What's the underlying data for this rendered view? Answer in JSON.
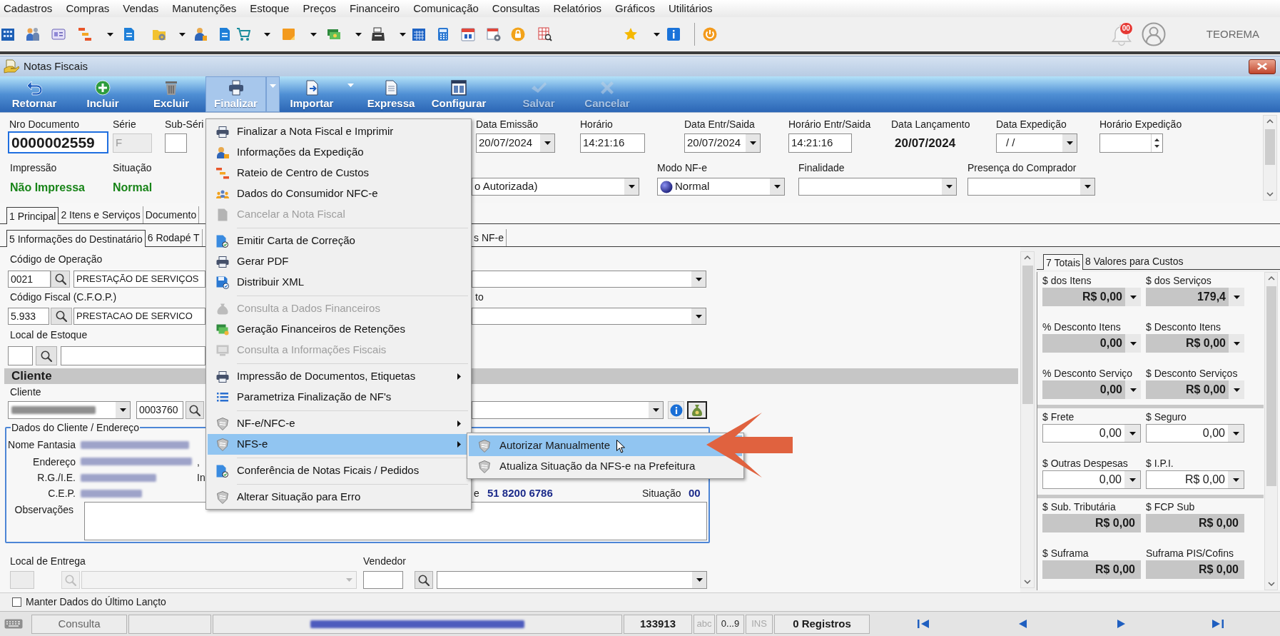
{
  "menu_bar": [
    "Cadastros",
    "Compras",
    "Vendas",
    "Manutenções",
    "Estoque",
    "Preços",
    "Financeiro",
    "Comunicação",
    "Consultas",
    "Relatórios",
    "Gráficos",
    "Utilitários"
  ],
  "top_bar": {
    "notification_count": "00",
    "user_name": "TEOREMA"
  },
  "window": {
    "title": "Notas Fiscais"
  },
  "ribbon": [
    {
      "label": "Retornar",
      "selected": false,
      "disabled": false,
      "dropdown": false
    },
    {
      "label": "Incluir",
      "selected": false,
      "disabled": false,
      "dropdown": false
    },
    {
      "label": "Excluir",
      "selected": false,
      "disabled": false,
      "dropdown": false
    },
    {
      "label": "Finalizar",
      "selected": true,
      "disabled": false,
      "dropdown": true
    },
    {
      "label": "Importar",
      "selected": false,
      "disabled": false,
      "dropdown": true
    },
    {
      "label": "Expressa",
      "selected": false,
      "disabled": false,
      "dropdown": false
    },
    {
      "label": "Configurar",
      "selected": false,
      "disabled": false,
      "dropdown": false
    },
    {
      "label": "Salvar",
      "selected": false,
      "disabled": true,
      "dropdown": false
    },
    {
      "label": "Cancelar",
      "selected": false,
      "disabled": true,
      "dropdown": false
    }
  ],
  "header": {
    "document_number": {
      "label": "Nro Documento",
      "value": "0000002559",
      "focused": true
    },
    "series": {
      "label": "Série",
      "value": "F",
      "disabled": true
    },
    "sub_series": {
      "label": "Sub-Séri"
    },
    "issue_date": {
      "label": "Data Emissão",
      "value": "20/07/2024"
    },
    "issue_time": {
      "label": "Horário",
      "value": "14:21:16"
    },
    "entry_exit_date": {
      "label": "Data Entr/Saida",
      "value": "20/07/2024"
    },
    "entry_exit_time": {
      "label": "Horário Entr/Saida",
      "value": "14:21:16"
    },
    "posting_date": {
      "label": "Data Lançamento",
      "value": "20/07/2024"
    },
    "shipping_date": {
      "label": "Data Expedição",
      "value": "/ /"
    },
    "shipping_time": {
      "label": "Horário Expedição"
    },
    "printing": {
      "label": "Impressão",
      "value": "Não Impressa"
    },
    "situation": {
      "label": "Situação",
      "value": "Normal"
    },
    "status": {
      "value": "o Autorizada)"
    },
    "nfe_mode": {
      "label": "Modo NF-e",
      "value": "Normal"
    },
    "purpose": {
      "label": "Finalidade"
    },
    "buyer_presence": {
      "label": "Presença do Comprador"
    }
  },
  "tabs": [
    {
      "label": "1 Principal",
      "selected": true
    },
    {
      "label": "2 Itens e Serviços",
      "selected": false
    },
    {
      "label": "Documento",
      "selected": false
    }
  ],
  "subtabs": [
    {
      "label": "5 Informações do Destinatário",
      "selected": true
    },
    {
      "label": "6 Rodapé T",
      "selected": false
    },
    {
      "label": "s NF-e",
      "selected": false
    }
  ],
  "form": {
    "operation": {
      "label": "Código de Operação",
      "code": "0021",
      "name": "PRESTAÇÃO DE SERVIÇOS"
    },
    "cfop": {
      "label": "Código Fiscal (C.F.O.P.)",
      "code": "5.933",
      "name": "PRESTACAO DE SERVICO",
      "column_2_label": "to"
    },
    "stock_location": {
      "label": "Local de Estoque"
    },
    "client": {
      "section_title": "Cliente",
      "label": "Cliente",
      "document_redacted": true,
      "code": "0003760"
    },
    "address": {
      "title": "Dados do Cliente / Endereço",
      "rows": [
        {
          "label": "Nome Fantasia",
          "redacted": true
        },
        {
          "label": "Endereço",
          "redacted": true,
          "fragment": ","
        },
        {
          "label": "R.G./I.E.",
          "redacted": true,
          "fragment": "In"
        },
        {
          "label": "C.E.P.",
          "redacted": true,
          "right_fields": [
            {
              "label": "e",
              "value": "51 8200 6786"
            },
            {
              "label": "Situação",
              "value": "00"
            }
          ]
        }
      ],
      "notes_label": "Observações"
    },
    "delivery_location": {
      "label": "Local de Entrega",
      "disabled": true
    },
    "seller": {
      "label": "Vendedor"
    }
  },
  "totals": {
    "tabs": [
      {
        "label": "7 Totais",
        "selected": true
      },
      {
        "label": "8 Valores para Custos",
        "selected": false
      }
    ],
    "sections": [
      [
        {
          "label": "$ dos Itens",
          "value": "R$ 0,00",
          "kind": "computed",
          "dropdown": true
        },
        {
          "label": "$ dos Serviços",
          "value": "179,4",
          "kind": "computed",
          "dropdown": true
        },
        {
          "label": "% Desconto Itens",
          "value": "0,00",
          "kind": "computed",
          "dropdown": true
        },
        {
          "label": "$ Desconto Itens",
          "value": "R$ 0,00",
          "kind": "computed",
          "dropdown": true
        },
        {
          "label": "% Desconto Serviço",
          "value": "0,00",
          "kind": "computed",
          "dropdown": true
        },
        {
          "label": "$ Desconto Serviços",
          "value": "R$ 0,00",
          "kind": "computed",
          "dropdown": true
        }
      ],
      [
        {
          "label": "$ Frete",
          "value": "0,00",
          "kind": "editable",
          "dropdown": true
        },
        {
          "label": "$ Seguro",
          "value": "0,00",
          "kind": "editable",
          "dropdown": true
        },
        {
          "label": "$ Outras Despesas",
          "value": "0,00",
          "kind": "editable",
          "dropdown": true
        },
        {
          "label": "$ I.P.I.",
          "value": "R$ 0,00",
          "kind": "editable",
          "dropdown": true
        }
      ],
      [
        {
          "label": "$ Sub. Tributária",
          "value": "R$ 0,00",
          "kind": "computed",
          "dropdown": false
        },
        {
          "label": "$ FCP Sub",
          "value": "R$ 0,00",
          "kind": "computed",
          "dropdown": false
        },
        {
          "label": "$ Suframa",
          "value": "R$ 0,00",
          "kind": "computed",
          "dropdown": false
        },
        {
          "label": "Suframa PIS/Cofins",
          "value": "R$ 0,00",
          "kind": "computed",
          "dropdown": false
        }
      ]
    ]
  },
  "keep_data": {
    "label": "Manter Dados do Último Lançto",
    "checked": false
  },
  "status_bar": {
    "mode": "Consulta",
    "user_redacted": true,
    "record": "133913",
    "indicators": [
      {
        "label": "abc",
        "on": false
      },
      {
        "label": "0...9",
        "on": true
      },
      {
        "label": "INS",
        "on": false
      }
    ],
    "records": "0 Registros"
  },
  "finalize_menu": {
    "groups": [
      [
        {
          "label": "Finalizar a Nota Fiscal e Imprimir",
          "disabled": false,
          "submenu": false,
          "selected": false
        },
        {
          "label": "Informações da Expedição",
          "disabled": false,
          "submenu": false,
          "selected": false
        },
        {
          "label": "Rateio de Centro de Custos",
          "disabled": false,
          "submenu": false,
          "selected": false
        },
        {
          "label": "Dados do Consumidor NFC-e",
          "disabled": false,
          "submenu": false,
          "selected": false
        },
        {
          "label": "Cancelar a Nota Fiscal",
          "disabled": true,
          "submenu": false,
          "selected": false
        }
      ],
      [
        {
          "label": "Emitir Carta de Correção",
          "disabled": false,
          "submenu": false,
          "selected": false
        },
        {
          "label": "Gerar PDF",
          "disabled": false,
          "submenu": false,
          "selected": false
        },
        {
          "label": "Distribuir XML",
          "disabled": false,
          "submenu": false,
          "selected": false
        }
      ],
      [
        {
          "label": "Consulta a Dados Financeiros",
          "disabled": true,
          "submenu": false,
          "selected": false
        },
        {
          "label": "Geração Financeiros de Retenções",
          "disabled": false,
          "submenu": false,
          "selected": false
        },
        {
          "label": "Consulta a Informações Fiscais",
          "disabled": true,
          "submenu": false,
          "selected": false
        }
      ],
      [
        {
          "label": "Impressão de Documentos, Etiquetas",
          "disabled": false,
          "submenu": true,
          "selected": false
        },
        {
          "label": "Parametriza Finalização de NF's",
          "disabled": false,
          "submenu": false,
          "selected": false
        }
      ],
      [
        {
          "label": "NF-e/NFC-e",
          "disabled": false,
          "submenu": true,
          "selected": false
        },
        {
          "label": "NFS-e",
          "disabled": false,
          "submenu": true,
          "selected": true
        }
      ],
      [
        {
          "label": "Conferência de Notas Ficais / Pedidos",
          "disabled": false,
          "submenu": false,
          "selected": false
        }
      ],
      [
        {
          "label": "Alterar Situação para Erro",
          "disabled": false,
          "submenu": false,
          "selected": false
        }
      ]
    ]
  },
  "nfse_submenu": [
    {
      "label": "Autorizar Manualmente",
      "selected": true
    },
    {
      "label": "Atualiza Situação da NFS-e na Prefeitura",
      "selected": false
    }
  ]
}
